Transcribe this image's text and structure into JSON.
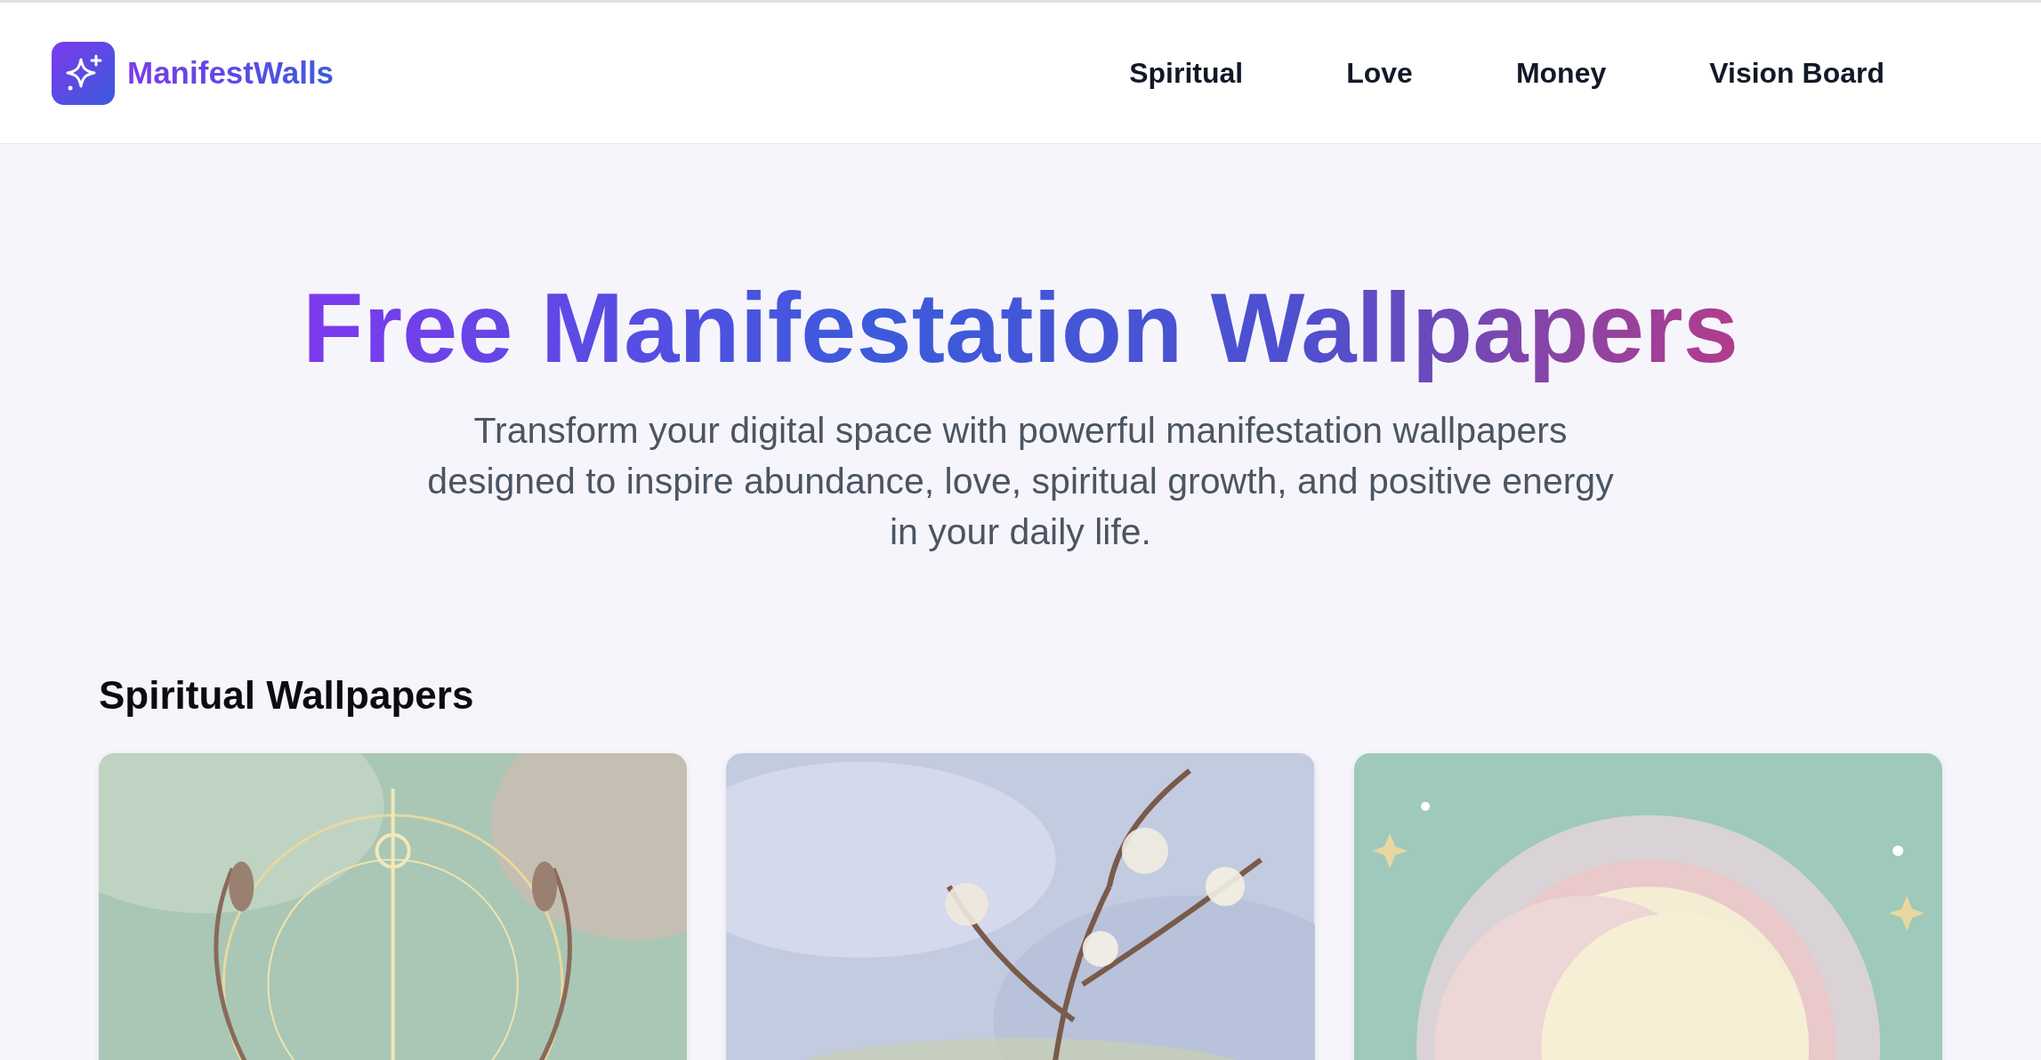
{
  "header": {
    "logo_text": "ManifestWalls",
    "nav": [
      {
        "label": "Spiritual"
      },
      {
        "label": "Love"
      },
      {
        "label": "Money"
      },
      {
        "label": "Vision Board"
      }
    ]
  },
  "hero": {
    "title": "Free Manifestation Wallpapers",
    "subtitle": "Transform your digital space with powerful manifestation wallpapers designed to inspire abundance, love, spiritual growth, and positive energy in your daily life."
  },
  "sections": [
    {
      "title": "Spiritual Wallpapers"
    }
  ]
}
